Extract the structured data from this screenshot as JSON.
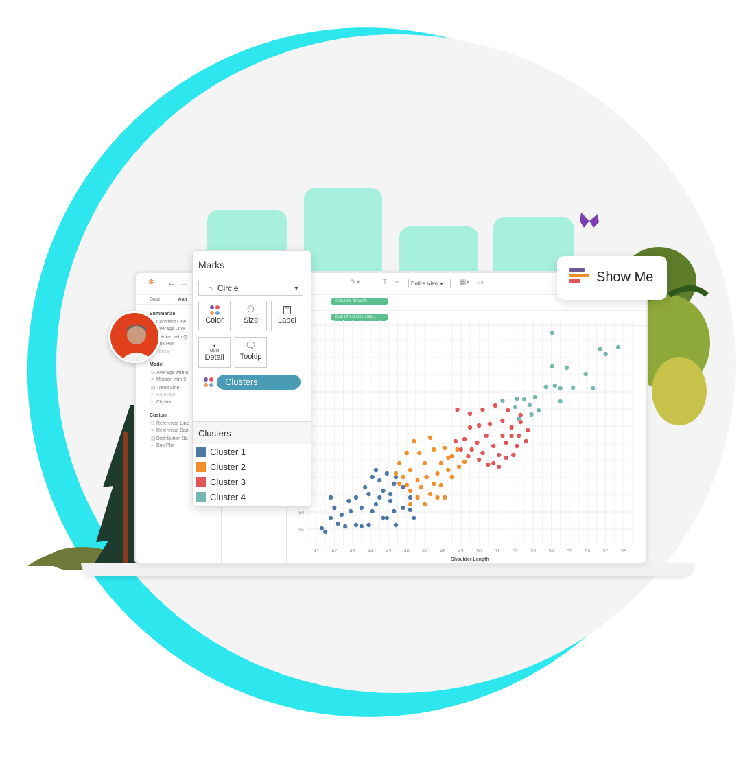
{
  "colors": {
    "accent": "#2ee6ee",
    "bars": "#a8f0de",
    "pill": "#5bbf8f",
    "clusters_pill": "#4a9bb5",
    "cluster1": "#4e79a7",
    "cluster2": "#f28e2b",
    "cluster3": "#e15759",
    "cluster4": "#76b7b2"
  },
  "toolbar": {
    "fit": "Entire View"
  },
  "left_pane": {
    "tabs": [
      "Data",
      "Ana"
    ],
    "sections": [
      {
        "title": "Summarize",
        "items": [
          "Constant Line",
          "Average Line",
          "Median with Q",
          "Box Plot",
          "Totals"
        ]
      },
      {
        "title": "Model",
        "items": [
          "Average with 9",
          "Median with 9",
          "Trend Line",
          "Forecast",
          "Cluster"
        ]
      },
      {
        "title": "Custom",
        "items": [
          "Reference Line",
          "Reference Ban",
          "Distribution Ba",
          "Box Plot"
        ]
      }
    ]
  },
  "shelves": {
    "columns_pill": "Shoulder Breadth",
    "rows_pill": "Bust Chest Circumfer.."
  },
  "marks": {
    "title": "Marks",
    "type": "Circle",
    "buttons": [
      "Color",
      "Size",
      "Label",
      "Detail",
      "Tooltip"
    ],
    "field": "Clusters",
    "icons": [
      "circle-icon",
      "color-dots-icon",
      "size-icon",
      "label-icon",
      "detail-icon",
      "tooltip-icon"
    ]
  },
  "legend": {
    "title": "Clusters",
    "items": [
      "Cluster 1",
      "Cluster 2",
      "Cluster 3",
      "Cluster 4"
    ]
  },
  "show_me": {
    "label": "Show Me"
  },
  "chart_data": {
    "type": "scatter",
    "xlabel": "Shoulder Length",
    "ylabel": "",
    "xticks": [
      41,
      42,
      43,
      44,
      45,
      46,
      47,
      48,
      49,
      50,
      51,
      52,
      53,
      54,
      55,
      56,
      57,
      58
    ],
    "yticks": [
      85,
      90
    ],
    "xlim": [
      40.5,
      58.5
    ],
    "ylim": [
      80,
      146
    ],
    "grid": true,
    "series": [
      {
        "name": "Cluster 1",
        "color": "#4e79a7",
        "points": [
          [
            41.5,
            84.2
          ],
          [
            41.8,
            88.2
          ],
          [
            42.4,
            89.2
          ],
          [
            42.9,
            90.2
          ],
          [
            42.0,
            91.2
          ],
          [
            43.2,
            94.2
          ],
          [
            43.5,
            91.2
          ],
          [
            43.9,
            95.2
          ],
          [
            44.3,
            92.2
          ],
          [
            44.7,
            96.2
          ],
          [
            45.1,
            93.2
          ],
          [
            45.3,
            98.2
          ],
          [
            44.5,
            99.2
          ],
          [
            44.1,
            100.2
          ],
          [
            44.9,
            101.2
          ],
          [
            45.4,
            100.2
          ],
          [
            45.8,
            97.2
          ],
          [
            46.2,
            94.2
          ],
          [
            45.3,
            90.2
          ],
          [
            44.7,
            88.2
          ],
          [
            43.9,
            86.2
          ],
          [
            43.2,
            86.2
          ],
          [
            42.6,
            85.8
          ],
          [
            43.5,
            85.8
          ],
          [
            42.2,
            86.6
          ],
          [
            41.3,
            85.2
          ],
          [
            41.8,
            94.2
          ],
          [
            42.8,
            93.2
          ],
          [
            45.8,
            91.2
          ],
          [
            46.4,
            88.2
          ],
          [
            44.3,
            102.2
          ],
          [
            44.9,
            88.2
          ],
          [
            45.4,
            86.2
          ],
          [
            46.2,
            90.6
          ],
          [
            44.1,
            90.2
          ],
          [
            44.5,
            94.2
          ],
          [
            43.7,
            97.2
          ],
          [
            45.1,
            95.2
          ]
        ]
      },
      {
        "name": "Cluster 2",
        "color": "#f28e2b",
        "points": [
          [
            46.4,
            110.6
          ],
          [
            47.3,
            111.6
          ],
          [
            46.7,
            107.2
          ],
          [
            47.5,
            108.2
          ],
          [
            48.1,
            108.6
          ],
          [
            48.5,
            106.2
          ],
          [
            47.9,
            104.2
          ],
          [
            47.0,
            104.2
          ],
          [
            46.2,
            102.2
          ],
          [
            45.8,
            100.2
          ],
          [
            46.6,
            99.2
          ],
          [
            47.1,
            100.2
          ],
          [
            47.7,
            101.2
          ],
          [
            48.3,
            102.2
          ],
          [
            48.9,
            103.2
          ],
          [
            49.2,
            104.6
          ],
          [
            46.2,
            96.2
          ],
          [
            46.8,
            97.2
          ],
          [
            47.3,
            95.2
          ],
          [
            47.9,
            97.8
          ],
          [
            48.5,
            100.2
          ],
          [
            45.6,
            104.2
          ],
          [
            45.4,
            101.2
          ],
          [
            46.0,
            97.8
          ],
          [
            46.6,
            94.2
          ],
          [
            47.0,
            92.2
          ],
          [
            47.7,
            94.2
          ],
          [
            48.8,
            108.2
          ],
          [
            48.3,
            105.8
          ],
          [
            49.6,
            108.2
          ],
          [
            45.6,
            98.2
          ],
          [
            46.2,
            92.2
          ],
          [
            47.5,
            98.2
          ],
          [
            48.1,
            94.2
          ],
          [
            46.0,
            107.2
          ]
        ]
      },
      {
        "name": "Cluster 3",
        "color": "#e15759",
        "points": [
          [
            48.8,
            119.8
          ],
          [
            49.5,
            118.6
          ],
          [
            50.2,
            119.8
          ],
          [
            50.9,
            121.0
          ],
          [
            51.6,
            119.6
          ],
          [
            50.6,
            115.6
          ],
          [
            51.3,
            116.6
          ],
          [
            51.8,
            114.6
          ],
          [
            52.3,
            116.2
          ],
          [
            52.7,
            113.8
          ],
          [
            52.1,
            109.2
          ],
          [
            52.6,
            110.6
          ],
          [
            51.9,
            106.6
          ],
          [
            51.1,
            106.6
          ],
          [
            50.2,
            107.2
          ],
          [
            49.2,
            111.2
          ],
          [
            49.5,
            114.6
          ],
          [
            49.9,
            110.2
          ],
          [
            50.4,
            112.2
          ],
          [
            50.8,
            109.2
          ],
          [
            51.5,
            110.2
          ],
          [
            51.3,
            112.2
          ],
          [
            50.0,
            115.2
          ],
          [
            49.6,
            108.2
          ],
          [
            49.0,
            108.2
          ],
          [
            48.7,
            110.6
          ],
          [
            52.3,
            118.2
          ],
          [
            51.8,
            112.2
          ],
          [
            50.5,
            103.8
          ],
          [
            50.8,
            104.2
          ],
          [
            50.0,
            105.2
          ],
          [
            49.4,
            106.2
          ],
          [
            51.5,
            105.8
          ],
          [
            51.1,
            103.2
          ],
          [
            52.2,
            112.2
          ]
        ]
      },
      {
        "name": "Cluster 4",
        "color": "#76b7b2",
        "points": [
          [
            54.05,
            142.2
          ],
          [
            56.7,
            137.4
          ],
          [
            57.0,
            136.0
          ],
          [
            57.7,
            138.0
          ],
          [
            54.05,
            132.4
          ],
          [
            54.85,
            132.0
          ],
          [
            53.7,
            126.4
          ],
          [
            54.2,
            126.8
          ],
          [
            54.5,
            126.0
          ],
          [
            55.2,
            126.2
          ],
          [
            56.3,
            126.0
          ],
          [
            55.9,
            130.2
          ],
          [
            52.5,
            122.8
          ],
          [
            53.1,
            123.4
          ],
          [
            54.5,
            122.2
          ],
          [
            53.3,
            119.6
          ],
          [
            51.3,
            122.4
          ],
          [
            52.1,
            123.0
          ],
          [
            52.9,
            118.4
          ],
          [
            52.0,
            120.6
          ],
          [
            52.2,
            117.2
          ],
          [
            52.8,
            121.2
          ]
        ]
      }
    ]
  }
}
